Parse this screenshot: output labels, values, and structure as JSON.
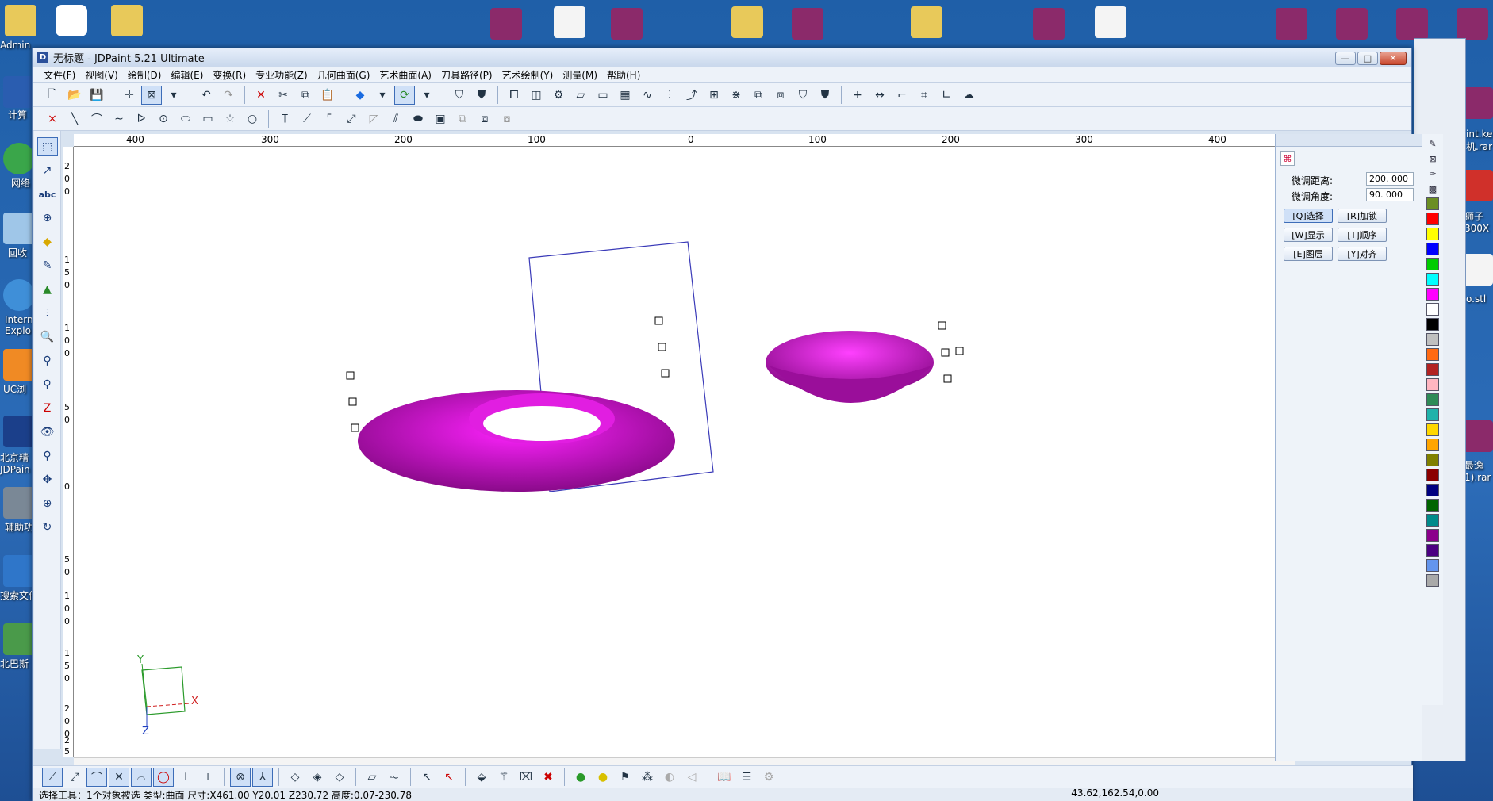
{
  "window": {
    "title": "无标题 - JDPaint 5.21 Ultimate",
    "logo": "D",
    "buttons": [
      "—",
      "□",
      "✕"
    ]
  },
  "menu": [
    "文件(F)",
    "视图(V)",
    "绘制(D)",
    "编辑(E)",
    "变换(R)",
    "专业功能(Z)",
    "几何曲面(G)",
    "艺术曲面(A)",
    "刀具路径(P)",
    "艺术绘制(Y)",
    "测量(M)",
    "帮助(H)"
  ],
  "desktop": {
    "labels": [
      "Admin",
      "计算",
      "网络",
      "回收",
      "Intern\nExplo",
      "UC浏",
      "北京精\nJDPain",
      "辅助功",
      "搜索文件",
      "北巴斯"
    ],
    "right_labels": [
      "int.ke\n机.rar",
      "狮子\n300X",
      "o.stl",
      "最逸\n1).rar"
    ]
  },
  "ruler": {
    "unit": "mm",
    "h_ticks": [
      "400",
      "300",
      "200",
      "100",
      "0",
      "100",
      "200",
      "300",
      "400"
    ],
    "v_ticks": [
      "2",
      "0",
      "0",
      "1",
      "5",
      "0",
      "1",
      "0",
      "0",
      "5",
      "0",
      "0",
      "5",
      "0",
      "1",
      "0",
      "0",
      "1",
      "5",
      "0",
      "2",
      "0",
      "0",
      "2",
      "5"
    ]
  },
  "axis": {
    "x": "X",
    "y": "Y",
    "z": "Z"
  },
  "panel": {
    "distance_label": "微调距离:",
    "distance_value": "200. 000",
    "angle_label": "微调角度:",
    "angle_value": "90. 000",
    "buttons": [
      "[Q]选择",
      "[R]加锁",
      "[W]显示",
      "[T]顺序",
      "[E]图层",
      "[Y]对齐"
    ]
  },
  "palette_colors": [
    "#6b8e23",
    "#ff0000",
    "#ffff00",
    "#0000ff",
    "#00cc00",
    "#00ffff",
    "#ff00ff",
    "#ffffff",
    "#000000",
    "#c0c0c0",
    "#ff6a13",
    "#b22222",
    "#ffb6c1",
    "#2e8b57",
    "#20b2aa",
    "#ffd700",
    "#ffa500",
    "#808000",
    "#8b0000",
    "#000080",
    "#006400",
    "#008b8b",
    "#8b008b",
    "#4b0082",
    "#6495ed",
    "#a9a9a9"
  ],
  "status": {
    "left": "选择工具：1个对象被选  类型:曲面  尺寸:X461.00 Y20.01 Z230.72 高度:0.07-230.78",
    "right": "43.62,162.54,0.00"
  }
}
